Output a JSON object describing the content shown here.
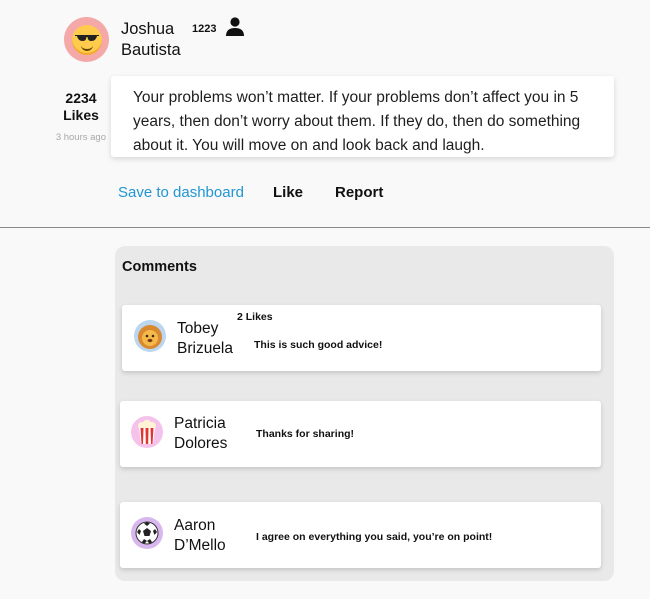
{
  "post": {
    "author": "Joshua Bautista",
    "avatar_icon": "sunglasses-face-icon",
    "avatar_bg": "#f4a9a8",
    "follower_count": "1223",
    "person_icon": "person-icon",
    "likes": "2234 Likes",
    "timestamp": "3 hours ago",
    "body": "Your problems won’t matter. If your problems don’t affect you in 5 years, then don’t worry about them. If they do, then do something about it. You will move on and look back and laugh."
  },
  "actions": {
    "save_label": "Save to dashboard",
    "like_label": "Like",
    "report_label": "Report",
    "link_color": "#2196d3"
  },
  "comments": {
    "title": "Comments",
    "items": [
      {
        "name": "Tobey Brizuela",
        "avatar_icon": "lion-icon",
        "likes": "2 Likes",
        "text": "This is such good advice!"
      },
      {
        "name": "Patricia Dolores",
        "avatar_icon": "popcorn-icon",
        "text": "Thanks for sharing!"
      },
      {
        "name": "Aaron D’Mello",
        "avatar_icon": "soccer-ball-icon",
        "text": "I agree on everything you said, you’re on point!"
      }
    ]
  }
}
